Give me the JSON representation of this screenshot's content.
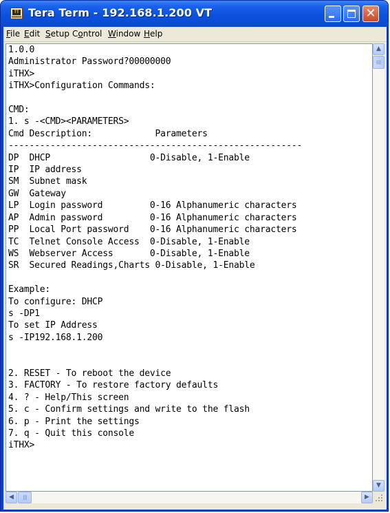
{
  "window": {
    "title": "Tera Term - 192.168.1.200 VT",
    "app_icon_label": "TT"
  },
  "menu": [
    "File",
    "Edit",
    "Setup",
    "Control",
    "Window",
    "Help"
  ],
  "menu_mnemonics": [
    "F",
    "E",
    "S",
    "o",
    "W",
    "H"
  ],
  "terminal": {
    "lines": [
      "1.0.0",
      "Administrator Password?00000000",
      "iTHX>",
      "iTHX>Configuration Commands:",
      "",
      "CMD:",
      "1. s -<CMD><PARAMETERS>",
      "Cmd Description:            Parameters",
      "--------------------------------------------------------",
      "DP  DHCP                   0-Disable, 1-Enable",
      "IP  IP address",
      "SM  Subnet mask",
      "GW  Gateway",
      "LP  Login password         0-16 Alphanumeric characters",
      "AP  Admin password         0-16 Alphanumeric characters",
      "PP  Local Port password    0-16 Alphanumeric characters",
      "TC  Telnet Console Access  0-Disable, 1-Enable",
      "WS  Webserver Access       0-Disable, 1-Enable",
      "SR  Secured Readings,Charts 0-Disable, 1-Enable",
      "",
      "Example:",
      "To configure: DHCP",
      "s -DP1",
      "To set IP Address",
      "s -IP192.168.1.200",
      "",
      "",
      "2. RESET - To reboot the device",
      "3. FACTORY - To restore factory defaults",
      "4. ? - Help/This screen",
      "5. c - Confirm settings and write to the flash",
      "6. p - Print the settings",
      "7. q - Quit this console",
      "iTHX>"
    ]
  },
  "colors": {
    "titlebar": "#0b51df",
    "close_button": "#cd4525",
    "menubar": "#ece9d8",
    "terminal_bg": "#ffffff",
    "terminal_fg": "#000000"
  },
  "icons": {
    "minimize": "minimize-icon",
    "maximize": "maximize-icon",
    "close": "close-icon",
    "scroll_up": "arrow-up-icon",
    "scroll_down": "arrow-down-icon",
    "scroll_left": "arrow-left-icon",
    "scroll_right": "arrow-right-icon"
  }
}
